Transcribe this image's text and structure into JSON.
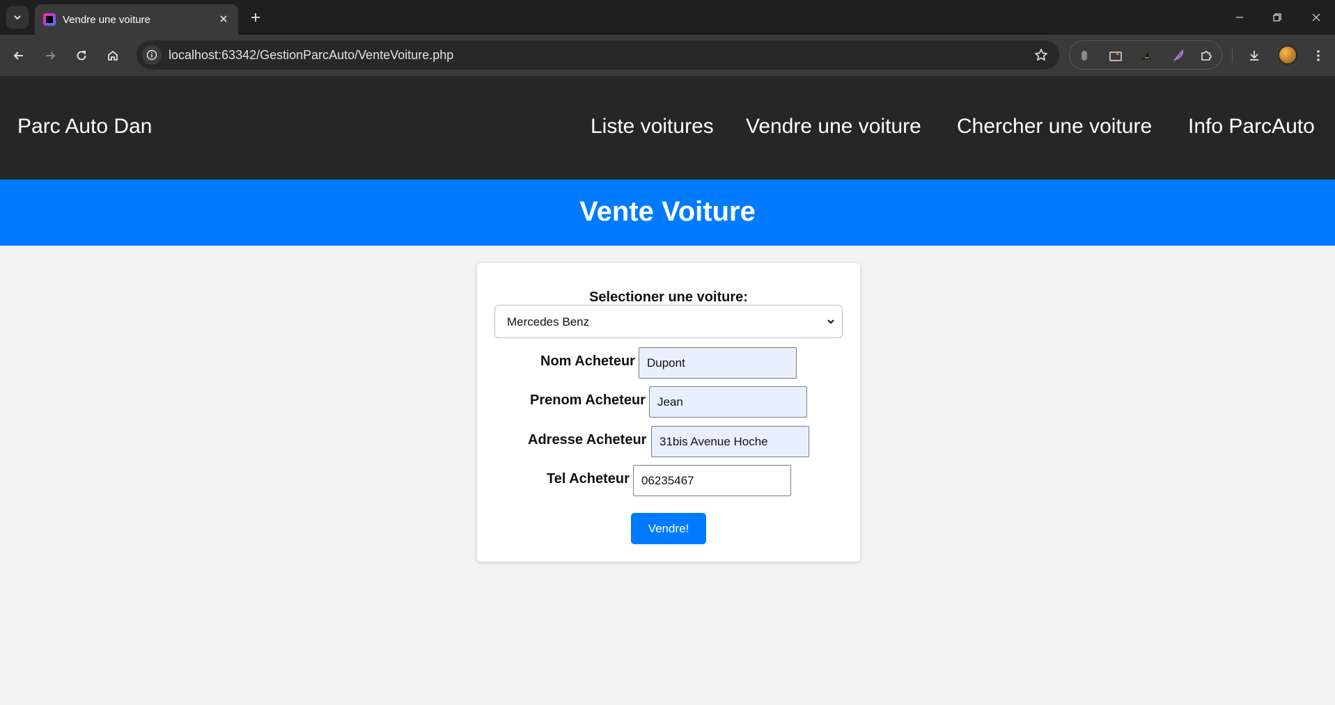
{
  "browser": {
    "tab_title": "Vendre une voiture",
    "url": "localhost:63342/GestionParcAuto/VenteVoiture.php"
  },
  "site": {
    "brand": "Parc Auto Dan",
    "nav": [
      "Liste voitures",
      "Vendre une voiture",
      "Chercher une voiture",
      "Info ParcAuto"
    ]
  },
  "banner": {
    "title": "Vente Voiture"
  },
  "form": {
    "select_label": "Selectioner une voiture:",
    "selected_car": "Mercedes Benz",
    "fields": [
      {
        "label": "Nom Acheteur",
        "value": "Dupont"
      },
      {
        "label": "Prenom Acheteur",
        "value": "Jean"
      },
      {
        "label": "Adresse Acheteur",
        "value": "31bis Avenue Hoche"
      },
      {
        "label": "Tel Acheteur",
        "value": "06235467"
      }
    ],
    "submit_label": "Vendre!"
  },
  "colors": {
    "nav_bg": "#262626",
    "banner_bg": "#007bff",
    "button_bg": "#007bff",
    "page_bg": "#f2f2f2",
    "autofill_bg": "#e8f0fe"
  }
}
